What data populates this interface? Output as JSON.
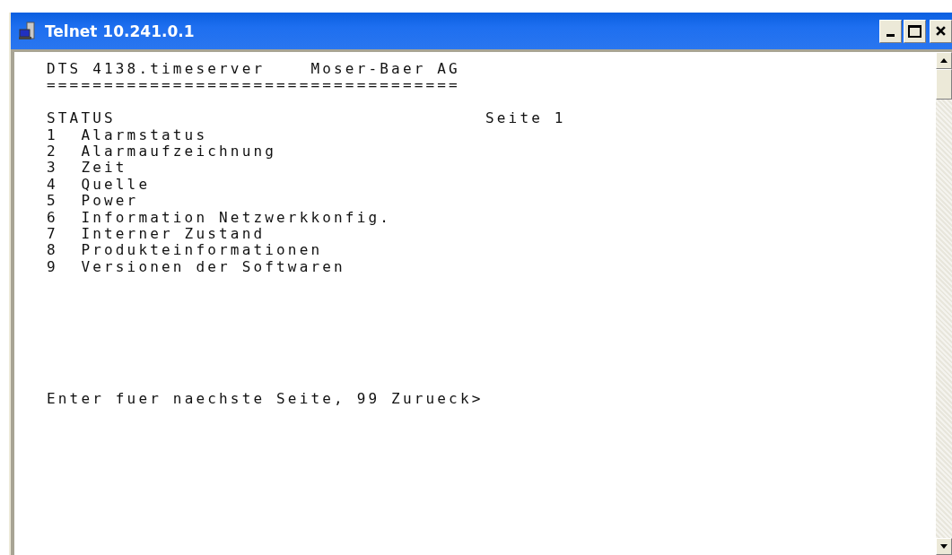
{
  "window": {
    "title": "Telnet 10.241.0.1"
  },
  "terminal": {
    "header": "DTS 4138.timeserver    Moser-Baer AG",
    "rule": "====================================",
    "section": "STATUS",
    "page": "Seite 1",
    "menu": [
      {
        "number": "1",
        "label": "Alarmstatus"
      },
      {
        "number": "2",
        "label": "Alarmaufzeichnung"
      },
      {
        "number": "3",
        "label": "Zeit"
      },
      {
        "number": "4",
        "label": "Quelle"
      },
      {
        "number": "5",
        "label": "Power"
      },
      {
        "number": "6",
        "label": "Information Netzwerkkonfig."
      },
      {
        "number": "7",
        "label": "Interner Zustand"
      },
      {
        "number": "8",
        "label": "Produkteinformationen"
      },
      {
        "number": "9",
        "label": "Versionen der Softwaren"
      }
    ],
    "prompt": "Enter fuer naechste Seite, 99 Zurueck>"
  }
}
